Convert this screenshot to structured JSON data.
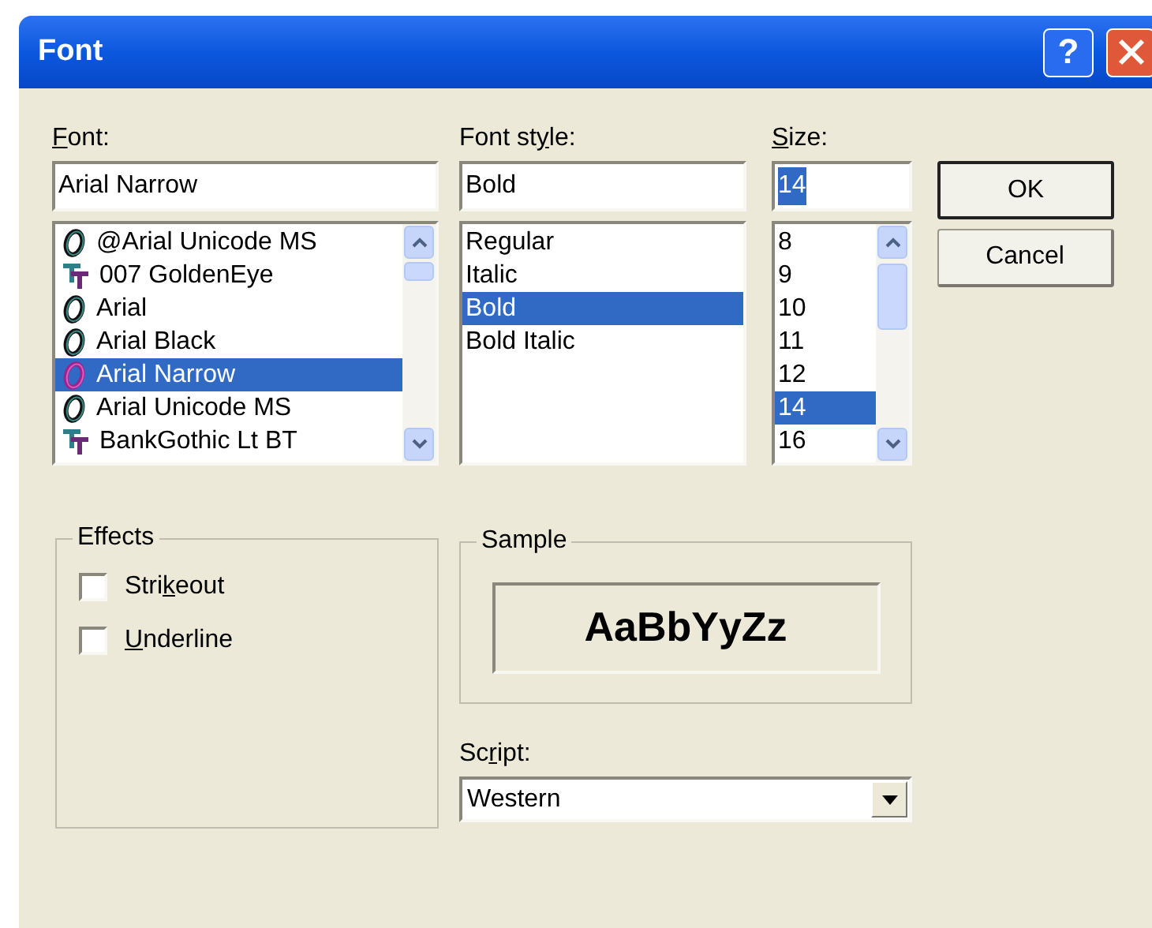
{
  "window": {
    "title": "Font",
    "help_label": "?"
  },
  "font": {
    "label": {
      "key": "F",
      "post": "ont:"
    },
    "value": "Arial Narrow",
    "items": [
      {
        "name": "@Arial Unicode MS",
        "kind": "opentype",
        "selected": false
      },
      {
        "name": "007 GoldenEye",
        "kind": "truetype",
        "selected": false
      },
      {
        "name": "Arial",
        "kind": "opentype",
        "selected": false
      },
      {
        "name": "Arial Black",
        "kind": "opentype",
        "selected": false
      },
      {
        "name": "Arial Narrow",
        "kind": "opentype",
        "selected": true
      },
      {
        "name": "Arial Unicode MS",
        "kind": "opentype",
        "selected": false
      },
      {
        "name": "BankGothic Lt BT",
        "kind": "truetype",
        "selected": false
      }
    ]
  },
  "font_style": {
    "label": {
      "pre": "Font st",
      "key": "y",
      "post": "le:"
    },
    "value": "Bold",
    "items": [
      {
        "name": "Regular",
        "selected": false
      },
      {
        "name": "Italic",
        "selected": false
      },
      {
        "name": "Bold",
        "selected": true
      },
      {
        "name": "Bold Italic",
        "selected": false
      }
    ]
  },
  "size": {
    "label": {
      "key": "S",
      "post": "ize:"
    },
    "value": "14",
    "value_highlighted": true,
    "items": [
      {
        "name": "8",
        "selected": false
      },
      {
        "name": "9",
        "selected": false
      },
      {
        "name": "10",
        "selected": false
      },
      {
        "name": "11",
        "selected": false
      },
      {
        "name": "12",
        "selected": false
      },
      {
        "name": "14",
        "selected": true
      },
      {
        "name": "16",
        "selected": false
      }
    ]
  },
  "buttons": [
    {
      "label": "OK",
      "default": true
    },
    {
      "label": "Cancel",
      "default": false
    }
  ],
  "effects": {
    "title": "Effects",
    "options": [
      {
        "label": {
          "pre": "Stri",
          "key": "k",
          "post": "eout"
        },
        "checked": false
      },
      {
        "label": {
          "key": "U",
          "post": "nderline"
        },
        "checked": false
      }
    ]
  },
  "sample": {
    "title": "Sample",
    "text": "AaBbYyZz"
  },
  "script": {
    "label": {
      "pre": "Sc",
      "key": "r",
      "post": "ipt:"
    },
    "value": "Western"
  }
}
